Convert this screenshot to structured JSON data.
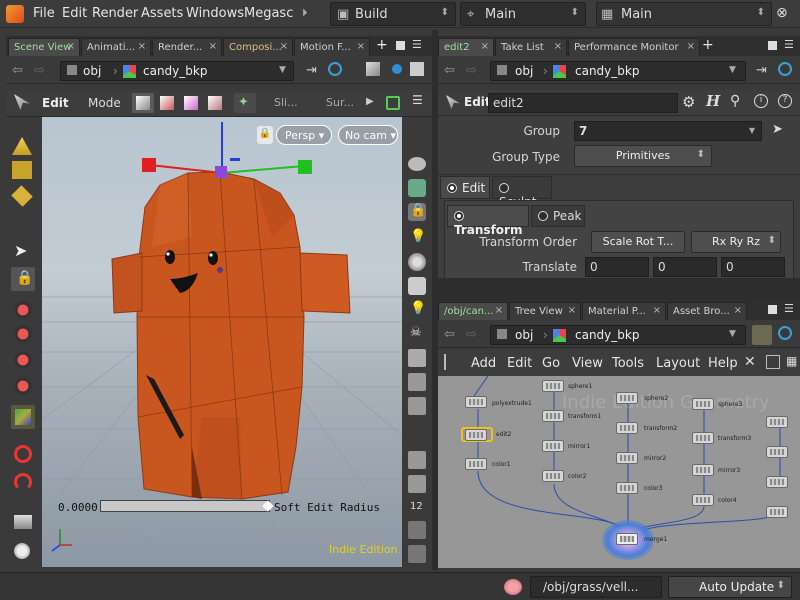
{
  "menubar": {
    "items": [
      "File",
      "Edit",
      "Render",
      "Assets",
      "Windows",
      "Megascar"
    ],
    "desktop": "Build",
    "context": "Main",
    "viewname": "Main"
  },
  "left_pane": {
    "tabs": [
      "Scene View",
      "Animati...",
      "Render...",
      "Composi...",
      "Motion F..."
    ],
    "path": "obj",
    "node": "candy_bkp",
    "toolbar": {
      "edit": "Edit",
      "mode": "Mode",
      "sli": "Sli...",
      "sur": "Sur..."
    },
    "viewport": {
      "persp": "Persp",
      "cam": "No cam",
      "radius_value": "0.0000",
      "radius_label": "Soft Edit Radius",
      "watermark": "Indie Edition"
    }
  },
  "param_pane": {
    "tabs": [
      "edit2",
      "Take List",
      "Performance Monitor"
    ],
    "path": "obj",
    "node": "candy_bkp",
    "edit_label": "Edit",
    "node_name": "edit2",
    "group_label": "Group",
    "group_value": "7",
    "group_type_label": "Group Type",
    "group_type_value": "Primitives",
    "mode_edit": "Edit",
    "mode_sculpt": "Sculpt",
    "sub_transform": "Transform",
    "sub_peak": "Peak",
    "transform_order_label": "Transform Order",
    "transform_order_value": "Scale Rot T...",
    "rot_order_value": "Rx Ry Rz",
    "translate_label": "Translate",
    "translate": [
      "0",
      "0",
      "0"
    ]
  },
  "network_pane": {
    "tabs": [
      "/obj/can...",
      "Tree View",
      "Material P...",
      "Asset Bro..."
    ],
    "path": "obj",
    "node": "candy_bkp",
    "menu": [
      "Add",
      "Edit",
      "Go",
      "View",
      "Tools",
      "Layout",
      "Help"
    ],
    "watermark": "Indie Edition Geometry",
    "nodes": [
      {
        "label": "polyextrude1"
      },
      {
        "label": "edit2"
      },
      {
        "label": "color1"
      },
      {
        "label": "sphere1"
      },
      {
        "label": "transform1"
      },
      {
        "label": "mirror1"
      },
      {
        "label": "color2"
      },
      {
        "label": "sphere2"
      },
      {
        "label": "transform2"
      },
      {
        "label": "mirror2"
      },
      {
        "label": "color3"
      },
      {
        "label": "sphere3"
      },
      {
        "label": "transform3"
      },
      {
        "label": "mirror3"
      },
      {
        "label": "color4"
      },
      {
        "label": "merge1"
      }
    ]
  },
  "statusbar": {
    "path": "/obj/grass/vell...",
    "update_mode": "Auto Update"
  },
  "colors": {
    "accent_green": "#9fe09a",
    "selected_node": "#f0c020",
    "character": "#c9561f"
  }
}
